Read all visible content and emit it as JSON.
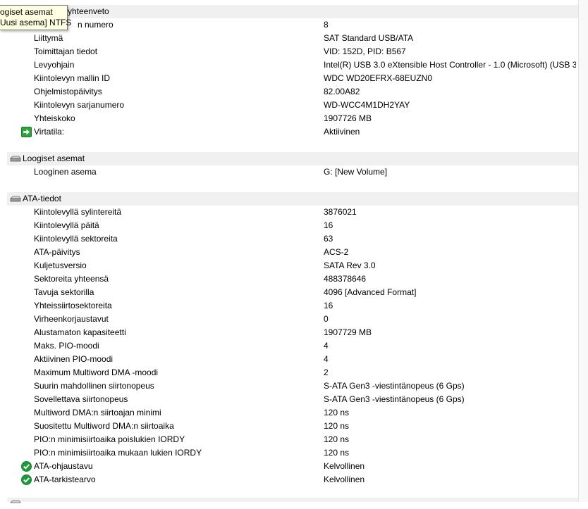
{
  "tooltip": {
    "line1": "ogiset asemat",
    "line2": "Uusi asema] NTFS"
  },
  "sections": {
    "overview": {
      "title": "yhteenveto"
    },
    "logical": {
      "title": "Loogiset asemat"
    },
    "ata": {
      "title": "ATA-tiedot"
    }
  },
  "overview_rows": [
    {
      "label": "n numero",
      "value": "8"
    },
    {
      "label": "Liittymä",
      "value": "SAT Standard USB/ATA"
    },
    {
      "label": "Toimittajan tiedot",
      "value": "VID: 152D, PID: B567"
    },
    {
      "label": "Levyohjain",
      "value": "Intel(R) USB 3.0 eXtensible Host Controller - 1.0 (Microsoft) (USB 3..."
    },
    {
      "label": "Kiintolevyn mallin ID",
      "value": "WDC WD20EFRX-68EUZN0"
    },
    {
      "label": "Ohjelmistopäivitys",
      "value": "82.00A82"
    },
    {
      "label": "Kiintolevyn sarjanumero",
      "value": "WD-WCC4M1DH2YAY"
    },
    {
      "label": "Yhteiskoko",
      "value": "1907726 MB"
    },
    {
      "label": "Virtatila:",
      "value": "Aktiivinen",
      "icon": "green-arrow-icon"
    }
  ],
  "logical_rows": [
    {
      "label": "Looginen asema",
      "value": "G: [New Volume]"
    }
  ],
  "ata_rows": [
    {
      "label": "Kiintolevyllä sylintereitä",
      "value": "3876021"
    },
    {
      "label": "Kiintolevyllä päitä",
      "value": "16"
    },
    {
      "label": "Kiintolevyllä sektoreita",
      "value": "63"
    },
    {
      "label": "ATA-päivitys",
      "value": "ACS-2"
    },
    {
      "label": "Kuljetusversio",
      "value": "SATA Rev 3.0"
    },
    {
      "label": "Sektoreita yhteensä",
      "value": "488378646"
    },
    {
      "label": "Tavuja sektorilla",
      "value": "4096 [Advanced Format]"
    },
    {
      "label": "Yhteissiirtosektoreita",
      "value": "16"
    },
    {
      "label": "Virheenkorjaustavut",
      "value": "0"
    },
    {
      "label": "Alustamaton kapasiteetti",
      "value": "1907729 MB"
    },
    {
      "label": "Maks. PIO-moodi",
      "value": "4"
    },
    {
      "label": "Aktiivinen PIO-moodi",
      "value": "4"
    },
    {
      "label": "Maximum Multiword DMA -moodi",
      "value": "2"
    },
    {
      "label": "Suurin mahdollinen siirtonopeus",
      "value": "S-ATA Gen3 -viestintänopeus (6 Gps)"
    },
    {
      "label": "Sovellettava siirtonopeus",
      "value": "S-ATA Gen3 -viestintänopeus (6 Gps)"
    },
    {
      "label": "Multiword DMA:n siirtoajan minimi",
      "value": "120 ns"
    },
    {
      "label": "Suositettu Multiword DMA:n siirtoaika",
      "value": "120 ns"
    },
    {
      "label": "PIO:n minimisiirtoaika poislukien IORDY",
      "value": "120 ns"
    },
    {
      "label": "PIO:n minimisiirtoaika mukaan lukien IORDY",
      "value": "120 ns"
    },
    {
      "label": "ATA-ohjaustavu",
      "value": "Kelvollinen",
      "icon": "green-check-icon"
    },
    {
      "label": "ATA-tarkistearvo",
      "value": "Kelvollinen",
      "icon": "green-check-icon"
    }
  ],
  "colors": {
    "section_bg": "#f0f0f0",
    "tooltip_bg": "#ffffe1",
    "ok_green": "#1e9c3c"
  }
}
